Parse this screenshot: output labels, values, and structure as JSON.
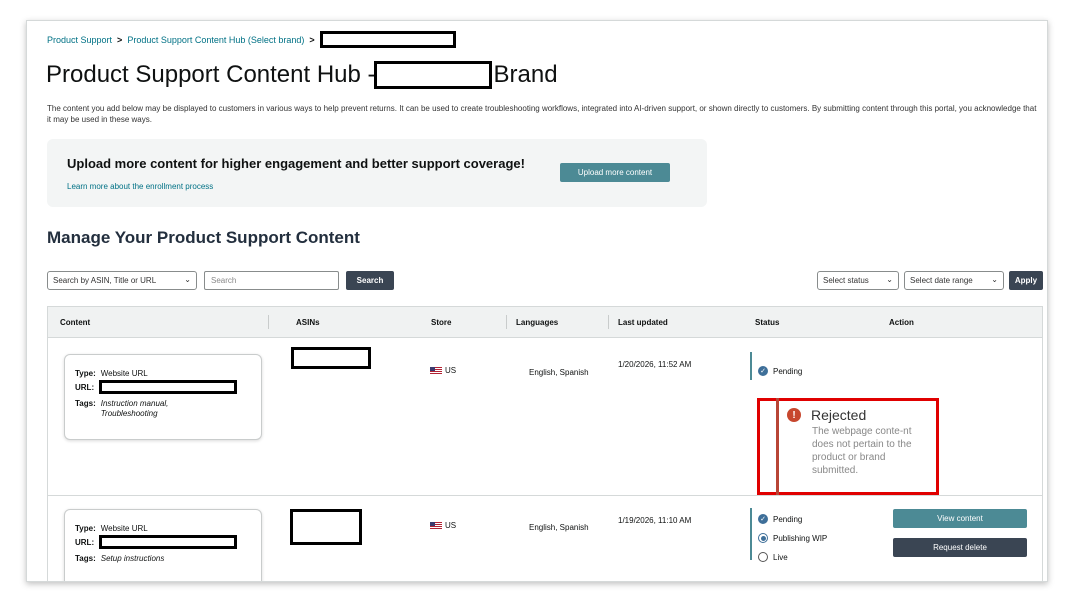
{
  "breadcrumb": {
    "item1": "Product Support",
    "item2": "Product Support Content Hub (Select brand)",
    "sep": ">"
  },
  "page": {
    "title_prefix": "Product Support Content Hub -",
    "title_suffix": "Brand",
    "description": "The content you add below may be displayed to customers in various ways to help prevent returns. It can be used to create troubleshooting workflows, integrated into AI-driven support, or shown directly to customers. By submitting content through this portal, you acknowledge that it may be used in these ways."
  },
  "banner": {
    "heading": "Upload more content for higher engagement and better support coverage!",
    "link": "Learn more about the enrollment process",
    "button": "Upload more content"
  },
  "section": {
    "title": "Manage Your Product Support Content"
  },
  "toolbar": {
    "search_by": "Search by ASIN, Title or URL",
    "search_placeholder": "Search",
    "search_button": "Search",
    "status_select": "Select status",
    "date_select": "Select date range",
    "apply_button": "Apply"
  },
  "table": {
    "headers": [
      "Content",
      "ASINs",
      "Store",
      "Languages",
      "Last updated",
      "Status",
      "Action"
    ],
    "rows": [
      {
        "type_label": "Type:",
        "type": "Website URL",
        "url_label": "URL:",
        "tags_label": "Tags:",
        "tags": "Instruction manual, Troubleshooting",
        "store": "US",
        "languages": "English, Spanish",
        "last_updated": "1/20/2026, 11:52 AM",
        "status": [
          {
            "label": "Pending",
            "state": "done"
          }
        ],
        "rejected_title": "Rejected",
        "rejected_text": "The webpage conte-nt does not pertain to the product or brand submitted."
      },
      {
        "type_label": "Type:",
        "type": "Website URL",
        "url_label": "URL:",
        "tags_label": "Tags:",
        "tags": "Setup instructions",
        "store": "US",
        "languages": "English, Spanish",
        "last_updated": "1/19/2026, 11:10 AM",
        "status": [
          {
            "label": "Pending",
            "state": "done"
          },
          {
            "label": "Publishing WIP",
            "state": "current"
          },
          {
            "label": "Live",
            "state": "todo"
          }
        ],
        "view_button": "View content",
        "delete_button": "Request delete"
      }
    ]
  },
  "colors": {
    "link": "#007185",
    "teal_button": "#4c8a95",
    "dark_button": "#3a4553",
    "rejected_outline": "#e00000",
    "error_icon": "#c7472e"
  }
}
